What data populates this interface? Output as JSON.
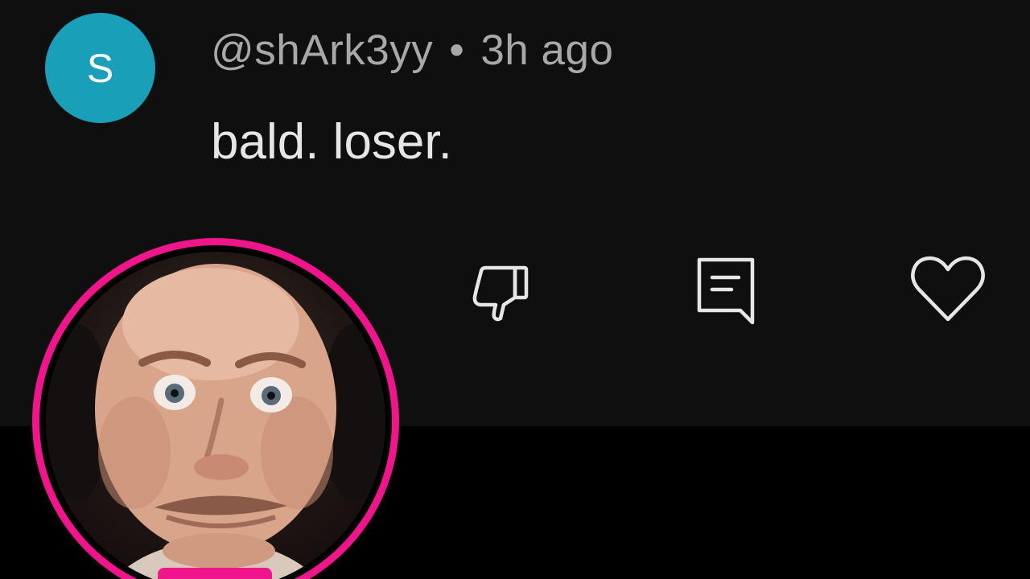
{
  "comment": {
    "avatar_letter": "S",
    "avatar_color": "#1a9fb8",
    "username": "@shArk3yy",
    "separator": "•",
    "timestamp": "3h ago",
    "text": "bald. loser."
  },
  "actions": {
    "dislike_icon": "thumbs-down-icon",
    "reply_icon": "comment-icon",
    "like_icon": "heart-icon"
  },
  "overlay": {
    "frame_color": "#f0158a",
    "content": "streamer webcam circle showing a bald man with wide eyes"
  },
  "colors": {
    "card_background": "#0f0f0f",
    "page_background": "#000000",
    "meta_text": "#a8a8a8",
    "comment_text": "#e6e6e6"
  }
}
